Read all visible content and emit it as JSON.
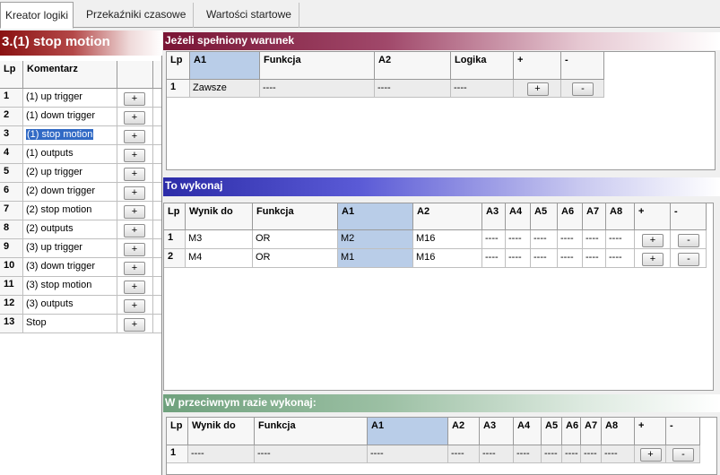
{
  "tabs": [
    {
      "label": "Kreator logiki",
      "active": true
    },
    {
      "label": "Przekaźniki czasowe",
      "active": false
    },
    {
      "label": "Wartości startowe",
      "active": false
    }
  ],
  "left": {
    "title": "3.(1) stop motion",
    "headers": {
      "lp": "Lp",
      "komentarz": "Komentarz"
    },
    "rows": [
      {
        "lp": "1",
        "komentarz": "(1) up trigger"
      },
      {
        "lp": "2",
        "komentarz": "(1) down trigger"
      },
      {
        "lp": "3",
        "komentarz": "(1) stop motion",
        "selected": true
      },
      {
        "lp": "4",
        "komentarz": "(1) outputs"
      },
      {
        "lp": "5",
        "komentarz": "(2) up trigger"
      },
      {
        "lp": "6",
        "komentarz": "(2) down trigger"
      },
      {
        "lp": "7",
        "komentarz": "(2) stop motion"
      },
      {
        "lp": "8",
        "komentarz": "(2) outputs"
      },
      {
        "lp": "9",
        "komentarz": "(3) up trigger"
      },
      {
        "lp": "10",
        "komentarz": "(3) down trigger"
      },
      {
        "lp": "11",
        "komentarz": "(3) stop motion"
      },
      {
        "lp": "12",
        "komentarz": "(3) outputs"
      },
      {
        "lp": "13",
        "komentarz": "Stop"
      }
    ],
    "add_label": "+"
  },
  "condition": {
    "title": "Jeżeli spełniony warunek",
    "headers": [
      "Lp",
      "A1",
      "Funkcja",
      "A2",
      "Logika"
    ],
    "rows": [
      {
        "lp": "1",
        "a1": "Zawsze",
        "funkcja": "----",
        "a2": "----",
        "logika": "----"
      }
    ],
    "add_label": "+",
    "remove_label": "-"
  },
  "then": {
    "title": "To wykonaj",
    "headers": [
      "Lp",
      "Wynik do",
      "Funkcja",
      "A1",
      "A2",
      "A3",
      "A4",
      "A5",
      "A6",
      "A7",
      "A8"
    ],
    "rows": [
      {
        "lp": "1",
        "wynik": "M3",
        "funkcja": "OR",
        "a1": "M2",
        "a2": "M16",
        "a3": "----",
        "a4": "----",
        "a5": "----",
        "a6": "----",
        "a7": "----",
        "a8": "----"
      },
      {
        "lp": "2",
        "wynik": "M4",
        "funkcja": "OR",
        "a1": "M1",
        "a2": "M16",
        "a3": "----",
        "a4": "----",
        "a5": "----",
        "a6": "----",
        "a7": "----",
        "a8": "----"
      }
    ],
    "add_label": "+",
    "remove_label": "-"
  },
  "else": {
    "title": "W przeciwnym razie wykonaj:",
    "headers": [
      "Lp",
      "Wynik do",
      "Funkcja",
      "A1",
      "A2",
      "A3",
      "A4",
      "A5",
      "A6",
      "A7",
      "A8"
    ],
    "rows": [
      {
        "lp": "1",
        "wynik": "----",
        "funkcja": "----",
        "a1": "----",
        "a2": "----",
        "a3": "----",
        "a4": "----",
        "a5": "----",
        "a6": "----",
        "a7": "----",
        "a8": "----"
      }
    ],
    "add_label": "+",
    "remove_label": "-"
  }
}
